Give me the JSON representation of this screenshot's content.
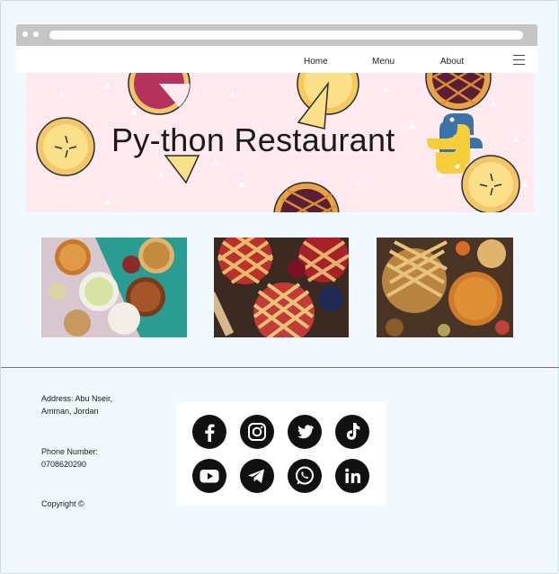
{
  "nav": {
    "links": [
      "Home",
      "Menu",
      "About"
    ],
    "menu_icon": "hamburger-icon"
  },
  "hero": {
    "title": "Py-thon Restaurant",
    "logo_icon": "python-logo-icon"
  },
  "gallery": {
    "images": [
      "pies-on-table-photo",
      "lattice-pies-photo",
      "pumpkin-pies-photo"
    ]
  },
  "footer": {
    "address": "Address: Abu Nseir, Amman, Jordan",
    "phone": "Phone Number: 0708620290",
    "copyright": "Copyright ©",
    "social_icons": [
      "facebook-icon",
      "instagram-icon",
      "twitter-icon",
      "tiktok-icon",
      "youtube-icon",
      "telegram-icon",
      "whatsapp-icon",
      "linkedin-icon"
    ]
  },
  "colors": {
    "page_bg": "#f1f8fe",
    "hero_bg": "#fde9ee",
    "social_icon": "#111111",
    "python_blue": "#3a73a8",
    "python_yellow": "#f6cd3b"
  }
}
